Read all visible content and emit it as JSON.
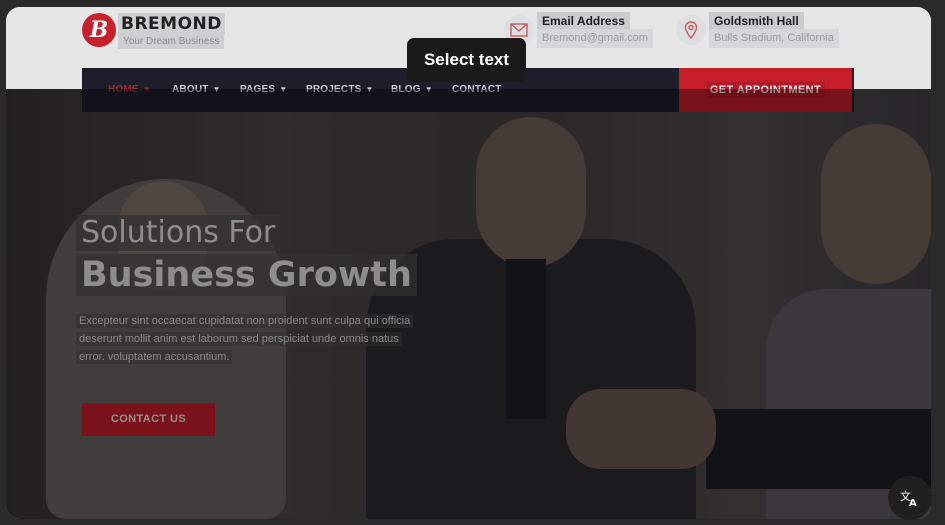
{
  "brand": {
    "name": "BREMOND",
    "tagline": "Your Dream Business",
    "logo_letter": "B"
  },
  "contact": [
    {
      "icon": "envelope-icon",
      "title": "Email Address",
      "value": "Bremond@gmail.com"
    },
    {
      "icon": "map-pin-icon",
      "title": "Goldsmith Hall",
      "value": "Bulls Stadium, California"
    }
  ],
  "nav": {
    "items": [
      {
        "label": "HOME",
        "has_caret": true,
        "active": true
      },
      {
        "label": "ABOUT",
        "has_caret": true
      },
      {
        "label": "PAGES",
        "has_caret": true
      },
      {
        "label": "PROJECTS",
        "has_caret": true
      },
      {
        "label": "BLOG",
        "has_caret": true
      },
      {
        "label": "CONTACT",
        "has_caret": false
      }
    ],
    "cta": "GET APPOINTMENT"
  },
  "hero": {
    "line1": "Solutions For",
    "line2": "Business Growth",
    "description": [
      "Excepteur sint occaecat cupidatat non proident sunt culpa qui officia",
      "deserunt mollit anim est laborum sed perspiciat unde omnis natus",
      "error. voluptatem accusantium."
    ],
    "button": "CONTACT US"
  },
  "overlay": {
    "tooltip": "Select text",
    "translate_icon": "translate-icon"
  },
  "colors": {
    "accent": "#c61d2b",
    "nav_bg": "#1d1e2a"
  }
}
